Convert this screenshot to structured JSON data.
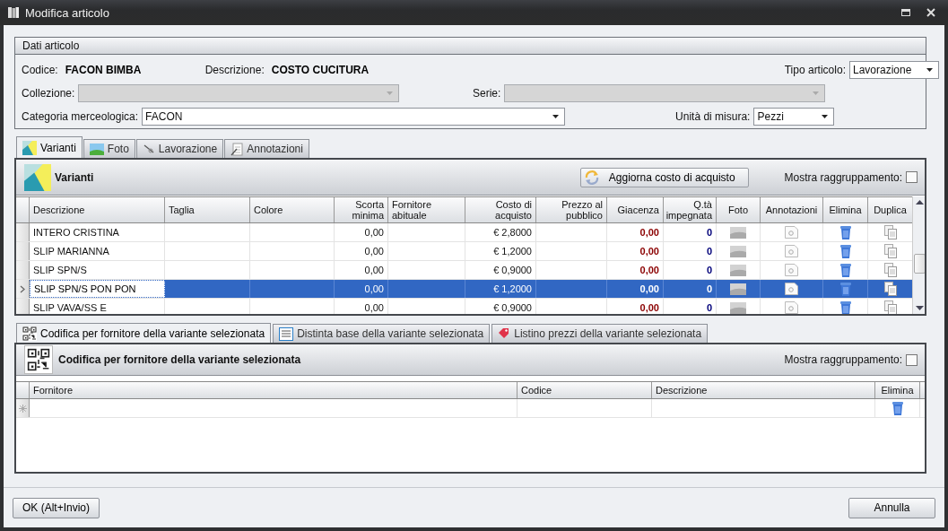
{
  "window": {
    "title": "Modifica articolo"
  },
  "article_data": {
    "title": "Dati articolo",
    "rows": [
      {
        "fields": [
          {
            "kind": "text",
            "label": "Codice:",
            "value": "FACON BIMBA",
            "disabled": false
          },
          {
            "kind": "text",
            "label": "Descrizione:",
            "value": "COSTO CUCITURA",
            "disabled": false
          },
          {
            "kind": "dropdown",
            "label": "Tipo articolo:",
            "value": "Lavorazione",
            "disabled": false
          }
        ]
      },
      {
        "fields": [
          {
            "kind": "dropdown",
            "label": "Collezione:",
            "disabled": true
          },
          {
            "kind": "dropdown",
            "label": "Serie:",
            "disabled": true
          }
        ]
      },
      {
        "fields": [
          {
            "kind": "dropdown",
            "label": "Categoria merceologica:",
            "value": "FACON",
            "disabled": false
          },
          {
            "kind": "dropdown",
            "label": "Unità di misura:",
            "value": "Pezzi",
            "disabled": false
          }
        ]
      }
    ]
  },
  "tabs": [
    {
      "label": "Varianti",
      "selected": true
    },
    {
      "label": "Foto",
      "selected": false
    },
    {
      "label": "Lavorazione",
      "selected": false
    },
    {
      "label": "Annotazioni",
      "selected": false
    }
  ],
  "variants": {
    "title": "Varianti",
    "update_button": "Aggiorna costo di acquisto",
    "grouping": {
      "label": "Mostra raggruppamento:",
      "checked": false
    },
    "columns": [
      {
        "label": "Descrizione",
        "kind": "text"
      },
      {
        "label": "Taglia",
        "kind": "text"
      },
      {
        "label": "Colore",
        "kind": "text"
      },
      {
        "label": "Scorta minima",
        "kind": "number"
      },
      {
        "label": "Fornitore abituale",
        "kind": "text"
      },
      {
        "label": "Costo di acquisto",
        "kind": "number"
      },
      {
        "label": "Prezzo al pubblico",
        "kind": "number"
      },
      {
        "label": "Giacenza",
        "kind": "stock"
      },
      {
        "label": "Q.tà impegnata",
        "kind": "committed"
      },
      {
        "label": "Foto",
        "kind": "photo"
      },
      {
        "label": "Annotazioni",
        "kind": "note"
      },
      {
        "label": "Elimina",
        "kind": "trash"
      },
      {
        "label": "Duplica",
        "kind": "copy"
      }
    ],
    "rows": [
      {
        "selected": false,
        "descrizione": "INTERO CRISTINA",
        "scorta_minima": "0,00",
        "costo_di_acquisto": "€ 2,8000",
        "giacenza": "0,00",
        "qta_impegnata": "0"
      },
      {
        "selected": false,
        "descrizione": "SLIP MARIANNA",
        "scorta_minima": "0,00",
        "costo_di_acquisto": "€ 1,2000",
        "giacenza": "0,00",
        "qta_impegnata": "0"
      },
      {
        "selected": false,
        "descrizione": "SLIP SPN/S",
        "scorta_minima": "0,00",
        "costo_di_acquisto": "€ 0,9000",
        "giacenza": "0,00",
        "qta_impegnata": "0"
      },
      {
        "selected": true,
        "descrizione": "SLIP SPN/S PON PON",
        "scorta_minima": "0,00",
        "costo_di_acquisto": "€ 1,2000",
        "giacenza": "0,00",
        "qta_impegnata": "0"
      },
      {
        "selected": false,
        "descrizione": "SLIP VAVA/SS E",
        "scorta_minima": "0,00",
        "costo_di_acquisto": "€ 0,9000",
        "giacenza": "0,00",
        "qta_impegnata": "0"
      }
    ]
  },
  "subtabs": [
    {
      "label": "Codifica per fornitore della variante selezionata",
      "selected": true
    },
    {
      "label": "Distinta base della variante selezionata",
      "selected": false
    },
    {
      "label": "Listino prezzi della variante selezionata",
      "selected": false
    }
  ],
  "supplier_codes": {
    "title": "Codifica per fornitore della variante selezionata",
    "grouping": {
      "label": "Mostra raggruppamento:",
      "checked": false
    },
    "columns": [
      {
        "label": "Fornitore",
        "kind": "text"
      },
      {
        "label": "Codice",
        "kind": "text"
      },
      {
        "label": "Descrizione",
        "kind": "text"
      },
      {
        "label": "Elimina",
        "kind": "trash"
      }
    ]
  },
  "buttons": [
    {
      "label": "OK (Alt+Invio)",
      "kind": "ok"
    },
    {
      "label": "Annulla",
      "kind": "cancel"
    }
  ]
}
